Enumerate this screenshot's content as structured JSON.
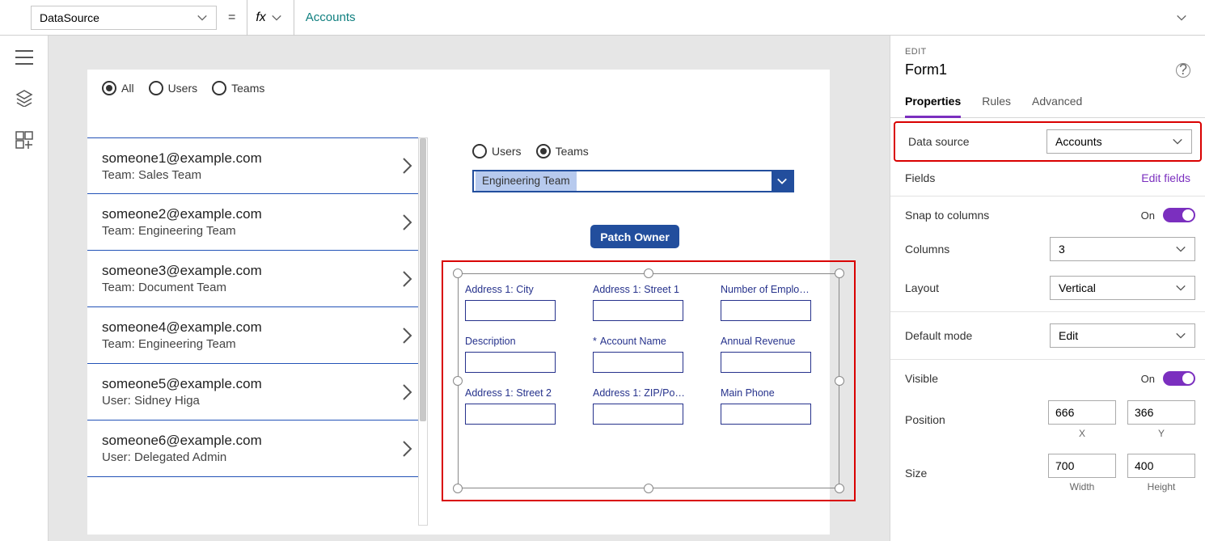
{
  "formula_bar": {
    "property": "DataSource",
    "equals": "=",
    "fx": "fx",
    "expression": "Accounts"
  },
  "canvas": {
    "filter_radios": {
      "all": "All",
      "users": "Users",
      "teams": "Teams"
    },
    "gallery": [
      {
        "email": "someone1@example.com",
        "sub": "Team: Sales Team"
      },
      {
        "email": "someone2@example.com",
        "sub": "Team: Engineering Team"
      },
      {
        "email": "someone3@example.com",
        "sub": "Team: Document Team"
      },
      {
        "email": "someone4@example.com",
        "sub": "Team: Engineering Team"
      },
      {
        "email": "someone5@example.com",
        "sub": "User: Sidney Higa"
      },
      {
        "email": "someone6@example.com",
        "sub": "User: Delegated Admin"
      }
    ],
    "owner_radios": {
      "users": "Users",
      "teams": "Teams"
    },
    "combo_value": "Engineering Team",
    "patch_label": "Patch Owner",
    "form_fields": [
      {
        "label": "Address 1: City",
        "required": false
      },
      {
        "label": "Address 1: Street 1",
        "required": false
      },
      {
        "label": "Number of Emplo…",
        "required": false
      },
      {
        "label": "Description",
        "required": false
      },
      {
        "label": "Account Name",
        "required": true
      },
      {
        "label": "Annual Revenue",
        "required": false
      },
      {
        "label": "Address 1: Street 2",
        "required": false
      },
      {
        "label": "Address 1: ZIP/Po…",
        "required": false
      },
      {
        "label": "Main Phone",
        "required": false
      }
    ]
  },
  "panel": {
    "edit": "EDIT",
    "name": "Form1",
    "tabs": {
      "properties": "Properties",
      "rules": "Rules",
      "advanced": "Advanced"
    },
    "data_source_label": "Data source",
    "data_source_value": "Accounts",
    "fields_label": "Fields",
    "edit_fields": "Edit fields",
    "snap_label": "Snap to columns",
    "snap_state": "On",
    "columns_label": "Columns",
    "columns_value": "3",
    "layout_label": "Layout",
    "layout_value": "Vertical",
    "default_mode_label": "Default mode",
    "default_mode_value": "Edit",
    "visible_label": "Visible",
    "visible_state": "On",
    "position_label": "Position",
    "pos_x": "666",
    "pos_y": "366",
    "pos_x_sub": "X",
    "pos_y_sub": "Y",
    "size_label": "Size",
    "size_w": "700",
    "size_h": "400",
    "size_w_sub": "Width",
    "size_h_sub": "Height"
  }
}
